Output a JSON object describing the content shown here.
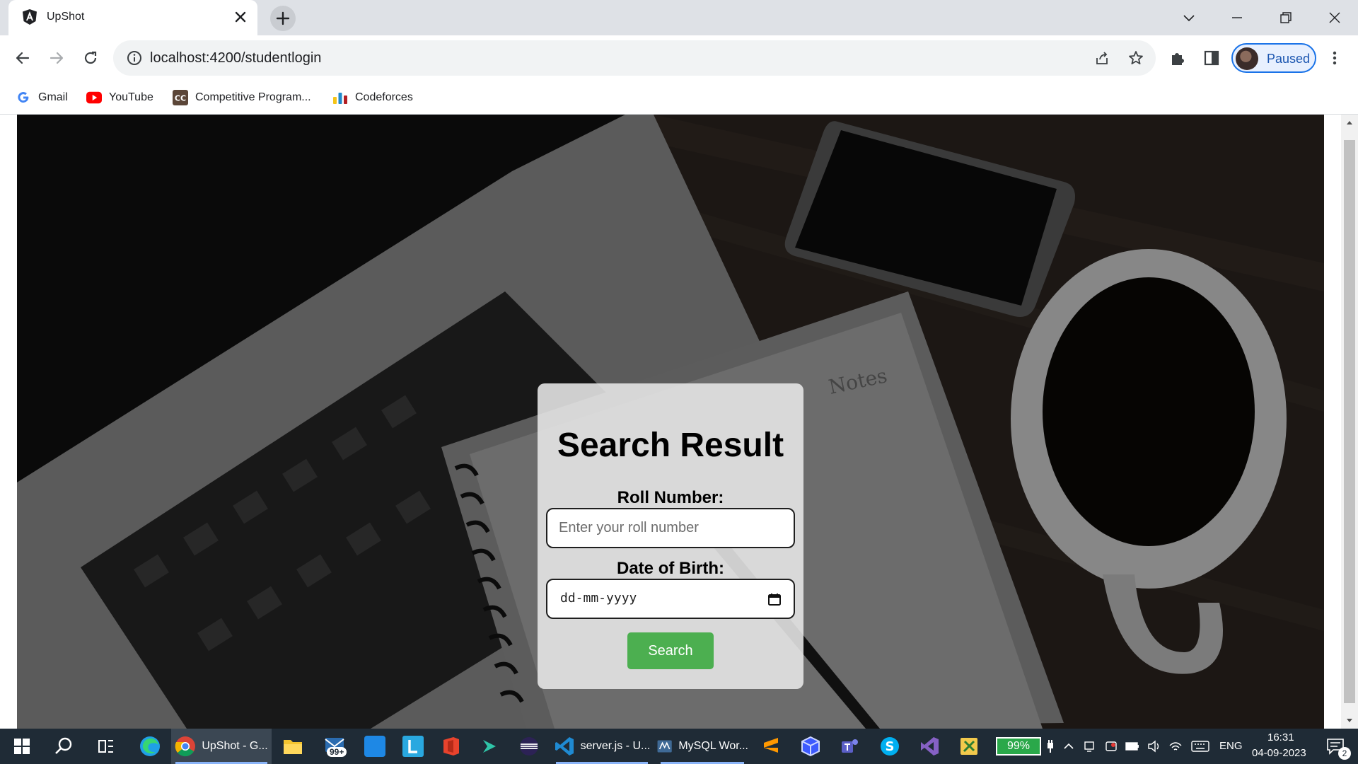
{
  "browser": {
    "tab": {
      "title": "UpShot"
    },
    "url": "localhost:4200/studentlogin",
    "profile": {
      "status": "Paused"
    },
    "bookmarks": [
      {
        "label": "Gmail",
        "icon": "google-icon"
      },
      {
        "label": "YouTube",
        "icon": "youtube-icon"
      },
      {
        "label": "Competitive Program...",
        "icon": "cc-icon"
      },
      {
        "label": "Codeforces",
        "icon": "codeforces-icon"
      }
    ]
  },
  "page": {
    "heading": "Search Result",
    "roll_label": "Roll Number:",
    "roll_placeholder": "Enter your roll number",
    "dob_label": "Date of Birth:",
    "dob_placeholder": "dd-mm-yyyy",
    "search_button": "Search",
    "background_text": "Notes",
    "colors": {
      "button": "#4caf50",
      "card": "#e8e8e8"
    }
  },
  "taskbar": {
    "chrome_label": "UpShot - G...",
    "mail_badge": "99+",
    "vscode_label": "server.js - U...",
    "mysql_label": "MySQL Wor...",
    "battery": "99%",
    "language": "ENG",
    "time": "16:31",
    "date": "04-09-2023",
    "notifications": "2"
  }
}
